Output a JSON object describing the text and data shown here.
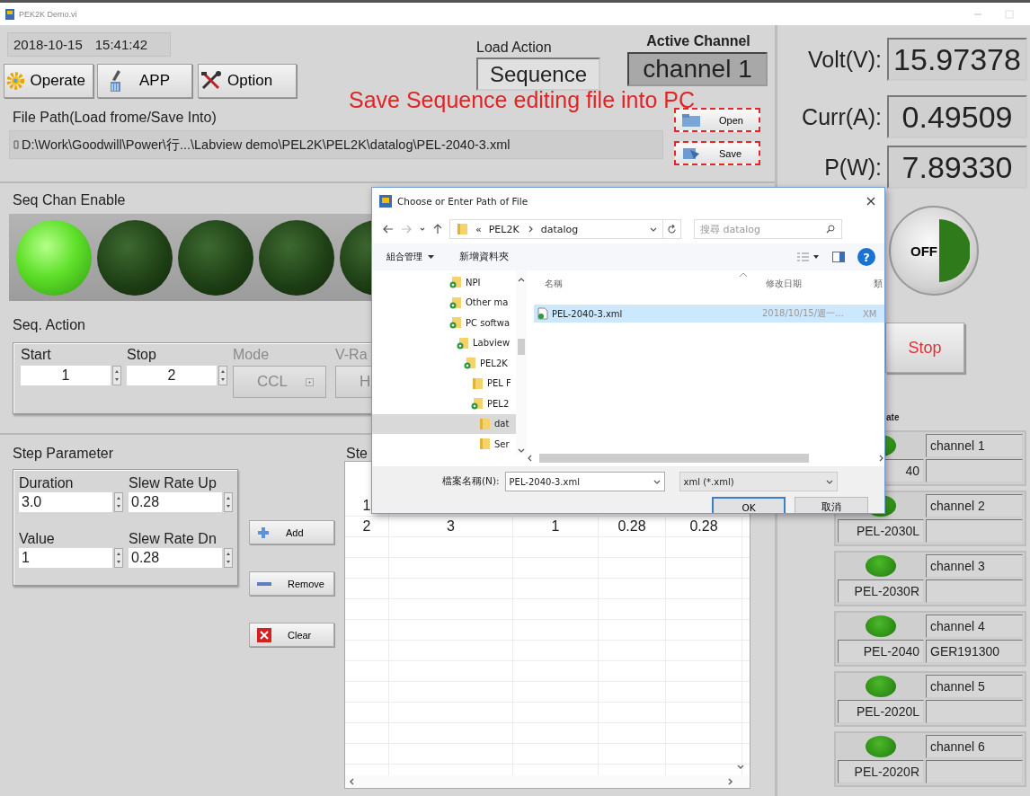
{
  "window": {
    "title": "PEK2K Demo.vi"
  },
  "clock": {
    "date": "2018-10-15",
    "time": "15:41:42"
  },
  "toolbar": [
    {
      "label": "Operate",
      "kind": "gear"
    },
    {
      "label": "APP",
      "kind": "brush"
    },
    {
      "label": "Option",
      "kind": "tools"
    }
  ],
  "load_action": {
    "label": "Load Action",
    "value": "Sequence"
  },
  "active_channel": {
    "label": "Active Channel",
    "value": "channel 1"
  },
  "annotation": "Save Sequence editing file into PC",
  "file_path": {
    "label": "File Path(Load frome/Save Into)",
    "value": "D:\\Work\\Goodwill\\Power\\行...\\Labview demo\\PEL2K\\PEL2K\\datalog\\PEL-2040-3.xml"
  },
  "file_buttons": [
    {
      "label": "Open",
      "kind": "open",
      "highlighted": true
    },
    {
      "label": "Save",
      "kind": "save",
      "highlighted": true
    }
  ],
  "seq_chan_enable": {
    "label": "Seq Chan Enable",
    "leds": [
      {
        "on": true
      },
      {
        "on": false
      },
      {
        "on": false
      },
      {
        "on": false
      },
      {
        "on": false
      }
    ]
  },
  "seq_action": {
    "label": "Seq. Action",
    "fields": [
      {
        "kind": "spinner",
        "label": "Start",
        "value": "1",
        "disabled": false
      },
      {
        "kind": "spinner",
        "label": "Stop",
        "value": "2",
        "disabled": false
      },
      {
        "kind": "dropdown",
        "label": "Mode",
        "value": "CCL",
        "disabled": true
      },
      {
        "kind": "dropdown",
        "label": "V-Ra",
        "value": "H",
        "disabled": true
      }
    ]
  },
  "step_parameter": {
    "label": "Step Parameter",
    "fields": [
      {
        "label": "Duration",
        "value": "3.0"
      },
      {
        "label": "Slew Rate Up",
        "value": "0.28"
      },
      {
        "label": "Value",
        "value": "1"
      },
      {
        "label": "Slew Rate Dn",
        "value": "0.28"
      }
    ]
  },
  "step_buttons": [
    {
      "label": "Add",
      "kind": "add"
    },
    {
      "label": "Remove",
      "kind": "remove"
    },
    {
      "label": "Clear",
      "kind": "clear"
    }
  ],
  "step_table": {
    "label": "Ste",
    "rows": [
      [
        "1"
      ],
      [
        "2",
        "3",
        "1",
        "0.28",
        "0.28"
      ]
    ]
  },
  "readouts": [
    {
      "label": "Volt(V):",
      "value": "15.97378"
    },
    {
      "label": "Curr(A):",
      "value": "0.49509"
    },
    {
      "label": "P(W):",
      "value": "7.89330"
    }
  ],
  "output_switch": {
    "label": "OFF",
    "on": false
  },
  "stop_button": {
    "label": "Stop"
  },
  "channel_state": {
    "label": "ate",
    "channels": [
      {
        "name": "channel 1",
        "model": "40",
        "on": true
      },
      {
        "name": "channel 2",
        "model": "PEL-2030L",
        "on": true
      },
      {
        "name": "channel 3",
        "model": "PEL-2030R",
        "on": true
      },
      {
        "name": "channel 4",
        "model": "PEL-2040",
        "serial": "GER191300",
        "on": true
      },
      {
        "name": "channel 5",
        "model": "PEL-2020L",
        "on": true
      },
      {
        "name": "channel 6",
        "model": "PEL-2020R",
        "on": true
      }
    ]
  },
  "dialog": {
    "title": "Choose or Enter Path of File",
    "breadcrumb": {
      "overflow": "«",
      "items": [
        "PEL2K",
        "datalog"
      ]
    },
    "search": {
      "placeholder": "搜尋 datalog"
    },
    "organize": "組合管理",
    "new_folder": "新增資料夾",
    "help": "?",
    "tree": [
      {
        "label": "NPI",
        "selected": false
      },
      {
        "label": "Other ma",
        "selected": false
      },
      {
        "label": "PC softwa",
        "selected": false,
        "children": [
          {
            "label": "Labview",
            "selected": false,
            "children": [
              {
                "label": "PEL2K",
                "selected": false,
                "children": [
                  {
                    "label": "PEL F",
                    "selected": false
                  },
                  {
                    "label": "PEL2",
                    "selected": false,
                    "children": [
                      {
                        "label": "dat",
                        "selected": true
                      },
                      {
                        "label": "Ser",
                        "selected": false
                      }
                    ]
                  }
                ]
              }
            ]
          }
        ]
      }
    ],
    "columns": [
      "名稱",
      "修改日期",
      "類"
    ],
    "files": [
      {
        "name": "PEL-2040-3.xml",
        "modified": "2018/10/15/週一…",
        "type": "XM",
        "selected": true
      }
    ],
    "filename_label": "檔案名稱(N):",
    "filename": "PEL-2040-3.xml",
    "filetype": "xml (*.xml)",
    "buttons": [
      {
        "label": "OK",
        "kind": "primary"
      },
      {
        "label": "取消",
        "kind": "secondary"
      }
    ]
  }
}
